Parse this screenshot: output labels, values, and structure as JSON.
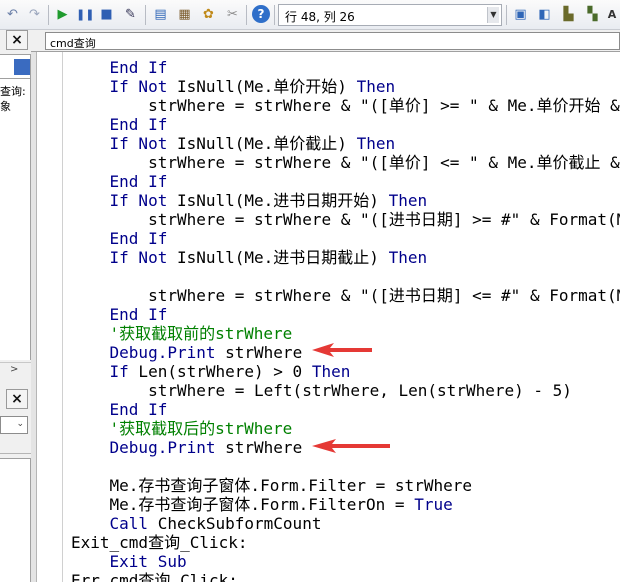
{
  "toolbar": {
    "cursor_position": "行 48, 列 26",
    "icons": [
      "undo-icon",
      "redo-icon",
      "run-icon",
      "break-icon",
      "reset-icon",
      "design-mode-icon",
      "project-explorer-icon",
      "properties-icon",
      "object-browser-icon",
      "toolbox-icon",
      "help-icon",
      "locals-icon",
      "immediate-icon",
      "watch-icon",
      "call-stack-icon",
      "font-icon"
    ]
  },
  "left_panel": {
    "close_top": "×",
    "close_bottom": "×",
    "text_1": "查询:",
    "text_2": "象",
    "scroll_arrow": ">"
  },
  "object_combo": "cmd查询",
  "code_lines": [
    {
      "indent": "    ",
      "tokens": [
        {
          "t": "End If",
          "c": "kw"
        }
      ]
    },
    {
      "indent": "    ",
      "tokens": [
        {
          "t": "If Not",
          "c": "kw"
        },
        {
          "t": " IsNull(Me.单价开始) ",
          "c": ""
        },
        {
          "t": "Then",
          "c": "kw"
        }
      ]
    },
    {
      "indent": "        ",
      "tokens": [
        {
          "t": "strWhere = strWhere & \"([单价] >= \" & Me.单价开始 & \") and \"",
          "c": ""
        }
      ]
    },
    {
      "indent": "    ",
      "tokens": [
        {
          "t": "End If",
          "c": "kw"
        }
      ]
    },
    {
      "indent": "    ",
      "tokens": [
        {
          "t": "If Not",
          "c": "kw"
        },
        {
          "t": " IsNull(Me.单价截止) ",
          "c": ""
        },
        {
          "t": "Then",
          "c": "kw"
        }
      ]
    },
    {
      "indent": "        ",
      "tokens": [
        {
          "t": "strWhere = strWhere & \"([单价] <= \" & Me.单价截止 & \") and \"",
          "c": ""
        }
      ]
    },
    {
      "indent": "    ",
      "tokens": [
        {
          "t": "End If",
          "c": "kw"
        }
      ]
    },
    {
      "indent": "    ",
      "tokens": [
        {
          "t": "If Not",
          "c": "kw"
        },
        {
          "t": " IsNull(Me.进书日期开始) ",
          "c": ""
        },
        {
          "t": "Then",
          "c": "kw"
        }
      ]
    },
    {
      "indent": "        ",
      "tokens": [
        {
          "t": "strWhere = strWhere & \"([进书日期] >= #\" & Format(Me.进书日期开始, \"yyyy-mm-dd\") & \"#) and \"",
          "c": ""
        }
      ]
    },
    {
      "indent": "    ",
      "tokens": [
        {
          "t": "End If",
          "c": "kw"
        }
      ]
    },
    {
      "indent": "    ",
      "tokens": [
        {
          "t": "If Not",
          "c": "kw"
        },
        {
          "t": " IsNull(Me.进书日期截止) ",
          "c": ""
        },
        {
          "t": "Then",
          "c": "kw"
        }
      ]
    },
    {
      "indent": "",
      "tokens": []
    },
    {
      "indent": "        ",
      "tokens": [
        {
          "t": "strWhere = strWhere & \"([进书日期] <= #\" & Format(Me.进书日期截止, \"yyyy-mm-dd\") & \"#) and \"",
          "c": ""
        }
      ]
    },
    {
      "indent": "    ",
      "tokens": [
        {
          "t": "End If",
          "c": "kw"
        }
      ]
    },
    {
      "indent": "    ",
      "tokens": [
        {
          "t": "'获取截取前的strWhere",
          "c": "cm"
        }
      ]
    },
    {
      "indent": "    ",
      "tokens": [
        {
          "t": "Debug.Print",
          "c": "kw"
        },
        {
          "t": " strWhere",
          "c": ""
        }
      ]
    },
    {
      "indent": "    ",
      "tokens": [
        {
          "t": "If",
          "c": "kw"
        },
        {
          "t": " Len(strWhere) > 0 ",
          "c": ""
        },
        {
          "t": "Then",
          "c": "kw"
        }
      ]
    },
    {
      "indent": "        ",
      "tokens": [
        {
          "t": "strWhere = Left(strWhere, Len(strWhere) - 5)",
          "c": ""
        }
      ]
    },
    {
      "indent": "    ",
      "tokens": [
        {
          "t": "End If",
          "c": "kw"
        }
      ]
    },
    {
      "indent": "    ",
      "tokens": [
        {
          "t": "'获取截取后的strWhere",
          "c": "cm"
        }
      ]
    },
    {
      "indent": "    ",
      "tokens": [
        {
          "t": "Debug.Print",
          "c": "kw"
        },
        {
          "t": " strWhere",
          "c": ""
        }
      ]
    },
    {
      "indent": "",
      "tokens": []
    },
    {
      "indent": "    ",
      "tokens": [
        {
          "t": "Me.存书查询子窗体.Form.Filter = strWhere",
          "c": ""
        }
      ]
    },
    {
      "indent": "    ",
      "tokens": [
        {
          "t": "Me.存书查询子窗体.Form.FilterOn = ",
          "c": ""
        },
        {
          "t": "True",
          "c": "kw"
        }
      ]
    },
    {
      "indent": "    ",
      "tokens": [
        {
          "t": "Call",
          "c": "kw"
        },
        {
          "t": " CheckSubformCount",
          "c": ""
        }
      ]
    },
    {
      "indent": "",
      "tokens": [
        {
          "t": "Exit_cmd查询_Click:",
          "c": ""
        }
      ]
    },
    {
      "indent": "    ",
      "tokens": [
        {
          "t": "Exit Sub",
          "c": "kw"
        }
      ]
    },
    {
      "indent": "",
      "tokens": [
        {
          "t": "Err_cmd查询_Click:",
          "c": ""
        }
      ]
    }
  ],
  "colors": {
    "keyword": "#00008b",
    "comment": "#008000",
    "arrow": "#e53935"
  }
}
